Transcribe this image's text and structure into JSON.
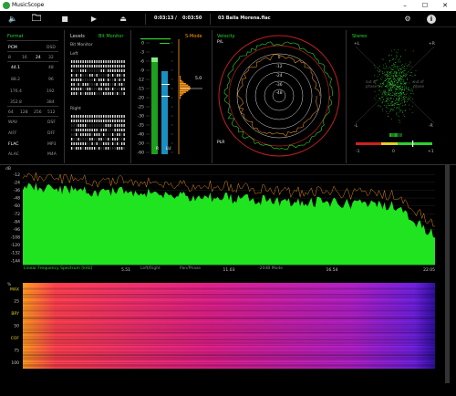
{
  "app": {
    "title": "MusicScope"
  },
  "window": {
    "minimize": "–",
    "maximize": "☐",
    "close": "✕"
  },
  "toolbar": {
    "current_time": "0:03:13",
    "time_separator": "/",
    "total_time": "0:03:50",
    "track": "03 Baila Morena.flac"
  },
  "format": {
    "title": "Format",
    "rows": [
      {
        "a": "PCM",
        "b": "DSD",
        "a_on": true,
        "b_on": false
      },
      {
        "a": "8",
        "b": "16",
        "c": "24",
        "d": "32",
        "on": "24"
      },
      {
        "a": "44.1",
        "b": "48",
        "on": "44.1"
      },
      {
        "a": "88.2",
        "b": "96"
      },
      {
        "a": "176.4",
        "b": "192"
      },
      {
        "a": "352.8",
        "b": "384"
      },
      {
        "a": "64",
        "b": "128",
        "c": "256",
        "d": "512"
      },
      {
        "a": "WAV",
        "b": "DSF"
      },
      {
        "a": "AIFF",
        "b": "DFF"
      },
      {
        "a": "FLAC",
        "b": "MP3",
        "a_on": true
      },
      {
        "a": "ALAC",
        "b": "M4A"
      }
    ]
  },
  "levels": {
    "title": "Levels",
    "bit_monitor_title": "Bit Monitor",
    "bit_monitor": "Bit Monitor",
    "left": "Left",
    "right": "Right"
  },
  "meter": {
    "scale": [
      "0",
      "-3",
      "-6",
      "-9",
      "-12",
      "-15",
      "-20",
      "-25",
      "-30",
      "-35",
      "-40",
      "-50",
      "-60"
    ],
    "l_label": "R",
    "r_label": "LU",
    "smode": "S-Mode",
    "readout": "5.0",
    "colors": {
      "peak": "#2fd02f",
      "rms": "#1aa0d0",
      "loud": "#ff9b1a"
    }
  },
  "velocity": {
    "title": "Velocity",
    "pl": "P/L",
    "plr": "PLR",
    "rings": [
      "0",
      "-12",
      "-24",
      "-36",
      "-48"
    ]
  },
  "stereo": {
    "title": "Stereo",
    "l": "+L",
    "r": "+R",
    "ml": "-L",
    "mr": "-R",
    "out1": "out of\nphase",
    "out2": "out of\nphase",
    "m1": "-1",
    "z": "0",
    "p1": "+1"
  },
  "spectrum": {
    "db_unit": "dB",
    "y_ticks": [
      "-12",
      "-24",
      "-36",
      "-48",
      "-60",
      "-72",
      "-84",
      "-96",
      "-108",
      "-120",
      "-132",
      "-144"
    ],
    "x_label": "Linear Frequency Spectrum [kHz]",
    "x_ticks": [
      "0",
      "5.51",
      "11.03",
      "16.54",
      "22.05"
    ],
    "modes": [
      "Left/Right",
      "Pan/Phase",
      "-20dB Mode"
    ],
    "colors": {
      "fill": "#1fe41f",
      "peak": "#e08a1c"
    }
  },
  "spectrogram": {
    "pct": "%",
    "y_ticks": [
      "MAX",
      "25",
      "BRY",
      "50",
      "COF",
      "75",
      "100"
    ]
  }
}
